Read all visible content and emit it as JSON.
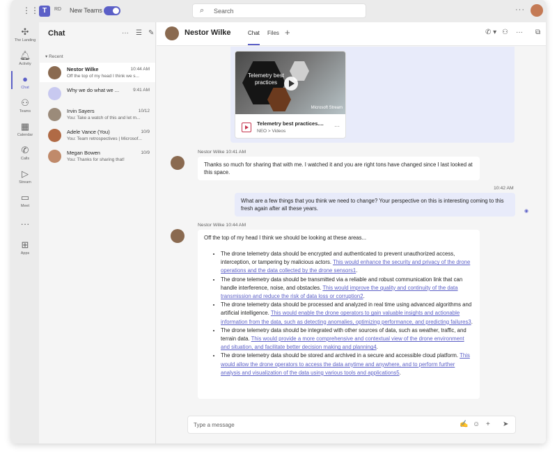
{
  "titlebar": {
    "badge": "RD",
    "new_teams_label": "New Teams",
    "search_placeholder": "Search"
  },
  "rail": {
    "items": [
      {
        "label": "The Landing",
        "icon": "drone-icon"
      },
      {
        "label": "Activity",
        "icon": "bell-icon"
      },
      {
        "label": "Chat",
        "icon": "chat-icon"
      },
      {
        "label": "Teams",
        "icon": "teams-icon"
      },
      {
        "label": "Calendar",
        "icon": "calendar-icon"
      },
      {
        "label": "Calls",
        "icon": "phone-icon"
      },
      {
        "label": "Stream",
        "icon": "stream-icon"
      },
      {
        "label": "Meet",
        "icon": "video-icon"
      },
      {
        "label": "Apps",
        "icon": "add-apps-icon"
      }
    ]
  },
  "chatlist": {
    "title": "Chat",
    "section": "Recent",
    "items": [
      {
        "name": "Nestor Wilke",
        "time": "10:44 AM",
        "preview": "Off the top of my head I think we s...",
        "color": "#8a6a50"
      },
      {
        "name": "Why we do what we ...",
        "time": "9:41 AM",
        "preview": "",
        "color": "#c8c9f0"
      },
      {
        "name": "Irvin Sayers",
        "time": "10/12",
        "preview": "You: Take a watch of this and let m...",
        "color": "#9b8b7a"
      },
      {
        "name": "Adele Vance (You)",
        "time": "10/9",
        "preview": "You: Team retrospectives | Microsof...",
        "color": "#b06a45"
      },
      {
        "name": "Megan Bowen",
        "time": "10/9",
        "preview": "You: Thanks for sharing that!",
        "color": "#c08a6a"
      }
    ]
  },
  "header": {
    "name": "Nestor Wilke",
    "tabs": [
      "Chat",
      "Files"
    ]
  },
  "video": {
    "thumb_title": "Telemetry best practices",
    "brand": "Microsoft Stream",
    "file_name": "Telemetry best practices....",
    "file_sub": "NEO > Videos"
  },
  "messages": {
    "m1_meta": "Nestor Wilke   10:41 AM",
    "m1_text": "Thanks so much for sharing that with me. I watched it and you are right tons have changed since I last looked at this space.",
    "m2_time": "10:42 AM",
    "m2_text": "What are a few things that you think we need to change? Your perspective on this is interesting coming to this fresh again after all these years.",
    "m3_meta": "Nestor Wilke   10:44 AM",
    "m3_intro": "Off the top of my head I think we should be looking at these areas...",
    "bullets": [
      {
        "text": "The drone telemetry data should be encrypted and authenticated to prevent unauthorized access, interception, or tampering by malicious actors. ",
        "link": "This would enhance the security and privacy of the drone operations and the data collected by the drone sensors1",
        "end": "."
      },
      {
        "text": "The drone telemetry data should be transmitted via a reliable and robust communication link that can handle interference, noise, and obstacles. ",
        "link": "This would improve the quality and continuity of the data transmission and reduce the risk of data loss or corruption2",
        "end": "."
      },
      {
        "text": "The drone telemetry data should be processed and analyzed in real time using advanced algorithms and artificial intelligence. ",
        "link": "This would enable the drone operators to gain valuable insights and actionable information from the data, such as detecting anomalies, optimizing performance, and predicting failures3",
        "end": "."
      },
      {
        "text": "The drone telemetry data should be integrated with other sources of data, such as weather, traffic, and terrain data. ",
        "link": "This would provide a more comprehensive and contextual view of the drone environment and situation, and facilitate better decision making and planning4",
        "end": "."
      },
      {
        "text": "The drone telemetry data should be stored and archived in a secure and accessible cloud platform. ",
        "link": "This would allow the drone operators to access the data anytime and anywhere, and to perform further analysis and visualization of the data using various tools and applications5",
        "end": "."
      }
    ]
  },
  "compose": {
    "placeholder": "Type a message"
  },
  "colors": {
    "accent": "#5b5fc7",
    "bubble_out": "#e8ebfa"
  }
}
